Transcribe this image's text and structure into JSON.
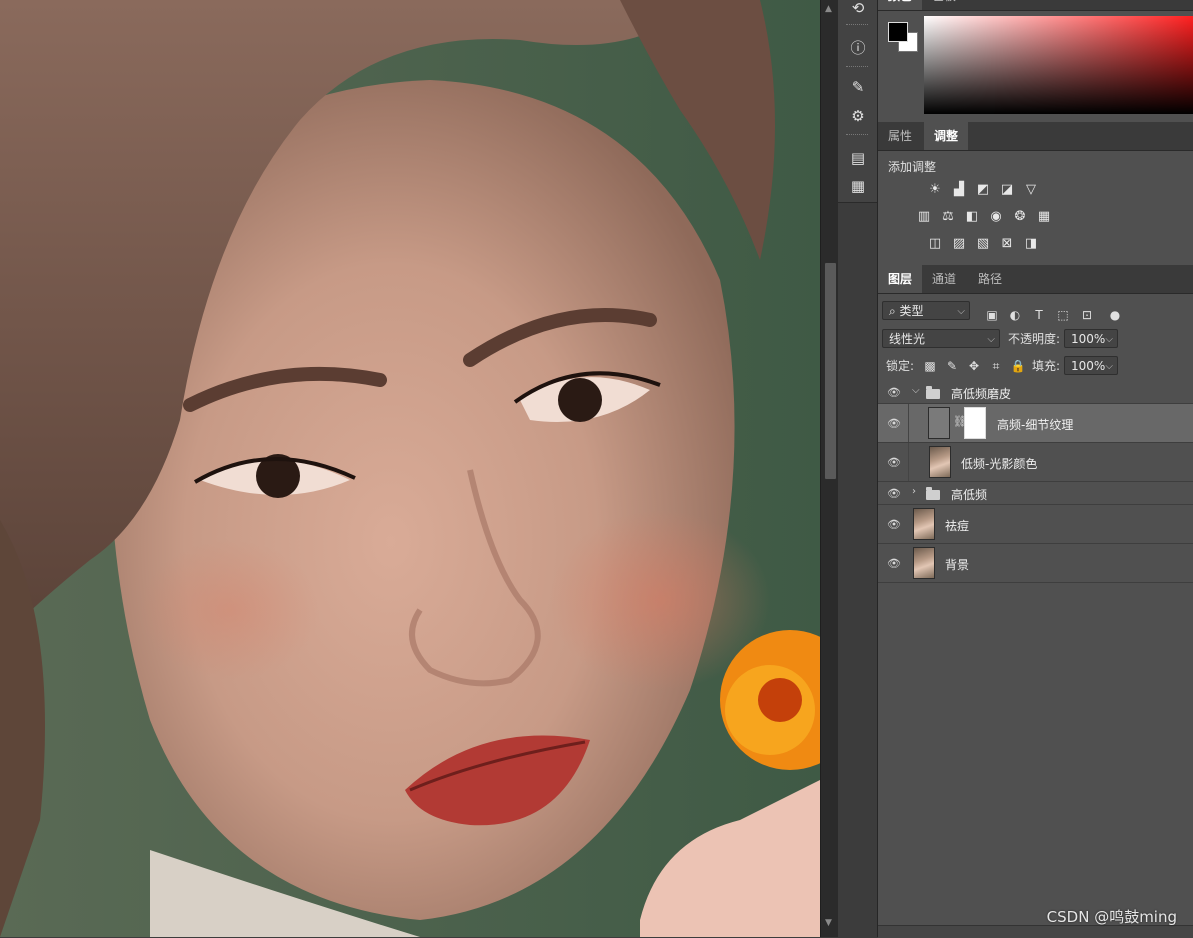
{
  "color_panel": {
    "tabs": [
      "颜色",
      "色板"
    ],
    "foreground_color": "#000000",
    "background_color": "#ffffff",
    "spectrum_hue": "#ff2020"
  },
  "adjust_panel": {
    "tabs": [
      "属性",
      "调整"
    ],
    "active_tab": "调整",
    "title": "添加调整",
    "icon_rows": [
      [
        "brightness-contrast-icon",
        "levels-icon",
        "curves-icon",
        "exposure-icon",
        "vibrance-icon"
      ],
      [
        "hue-saturation-icon",
        "color-balance-icon",
        "black-white-icon",
        "photo-filter-icon",
        "channel-mixer-icon",
        "color-lookup-icon"
      ],
      [
        "invert-icon",
        "posterize-icon",
        "threshold-icon",
        "selective-color-icon",
        "gradient-map-icon"
      ]
    ]
  },
  "layers_panel": {
    "tabs": [
      "图层",
      "通道",
      "路径"
    ],
    "active_tab": "图层",
    "filter_kind": "类型",
    "blend_mode": "线性光",
    "opacity_label": "不透明度:",
    "opacity_value": "100%",
    "lock_label": "锁定:",
    "fill_label": "填充:",
    "fill_value": "100%",
    "layers": [
      {
        "name": "高低频磨皮",
        "kind": "group",
        "expanded": true
      },
      {
        "name": "高频-细节纹理",
        "kind": "layer-with-mask",
        "selected": true
      },
      {
        "name": "低频-光影颜色",
        "kind": "layer"
      },
      {
        "name": "高低频",
        "kind": "group",
        "expanded": false
      },
      {
        "name": "祛痘",
        "kind": "layer"
      },
      {
        "name": "背景",
        "kind": "layer"
      }
    ]
  },
  "watermark": "CSDN @鸣鼓ming"
}
